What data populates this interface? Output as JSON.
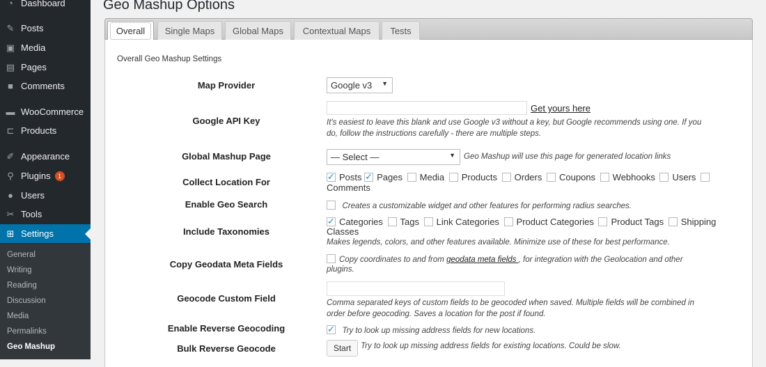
{
  "sidebar": {
    "items": [
      {
        "label": "Dashboard",
        "icon": "dashboard-icon"
      },
      {
        "label": "Posts",
        "icon": "pin-icon"
      },
      {
        "label": "Media",
        "icon": "media-icon"
      },
      {
        "label": "Pages",
        "icon": "pages-icon"
      },
      {
        "label": "Comments",
        "icon": "comment-icon"
      },
      {
        "label": "WooCommerce",
        "icon": "woocommerce-icon"
      },
      {
        "label": "Products",
        "icon": "cart-icon"
      },
      {
        "label": "Appearance",
        "icon": "brush-icon"
      },
      {
        "label": "Plugins",
        "icon": "plug-icon",
        "badge": "1"
      },
      {
        "label": "Users",
        "icon": "user-icon"
      },
      {
        "label": "Tools",
        "icon": "wrench-icon"
      },
      {
        "label": "Settings",
        "icon": "settings-icon"
      }
    ],
    "submenu": [
      "General",
      "Writing",
      "Reading",
      "Discussion",
      "Media",
      "Permalinks",
      "Geo Mashup"
    ],
    "colors": {
      "bg": "#23282d",
      "active": "#0073aa",
      "submenu_bg": "#32373c"
    }
  },
  "page": {
    "title": "Geo Mashup Options"
  },
  "tabs": [
    "Overall",
    "Single Maps",
    "Global Maps",
    "Contextual Maps",
    "Tests"
  ],
  "section_title": "Overall Geo Mashup Settings",
  "settings": {
    "map_provider": {
      "label": "Map Provider",
      "value": "Google v3"
    },
    "google_api_key": {
      "label": "Google API Key",
      "value": "",
      "link": "Get yours here",
      "desc_line1": "It's easiest to leave this blank and use Google v3 without a key, but Google recommends using one. If you",
      "desc_line2": "do, follow the instructions carefully - there are multiple steps."
    },
    "global_mashup_page": {
      "label": "Global Mashup Page",
      "value": "— Select —",
      "desc": "Geo Mashup will use this page for generated location links"
    },
    "collect_location": {
      "label": "Collect Location For",
      "options": [
        "Posts",
        "Pages",
        "Media",
        "Products",
        "Orders",
        "Coupons",
        "Webhooks",
        "Users",
        "Comments"
      ]
    },
    "geo_search": {
      "label": "Enable Geo Search",
      "desc": "Creates a customizable widget and other features for performing radius searches."
    },
    "taxonomies": {
      "label": "Include Taxonomies",
      "options": [
        "Categories",
        "Tags",
        "Link Categories",
        "Product Categories",
        "Product Tags",
        "Shipping",
        "Classes"
      ],
      "desc": "Makes legends, colors, and other features available. Minimize use of these for best performance."
    },
    "copy_meta": {
      "label": "Copy Geodata Meta Fields",
      "desc_pre": "Copy coordinates to and from ",
      "desc_link": "geodata meta fields ",
      "desc_post": ", for integration with the Geolocation and other",
      "desc_line2": "plugins."
    },
    "geocode_custom": {
      "label": "Geocode Custom Field",
      "value": "",
      "desc_line1": "Comma separated keys of custom fields to be geocoded when saved. Multiple fields will be combined in",
      "desc_line2": "order before geocoding. Saves a location for the post if found."
    },
    "reverse_geocoding": {
      "label": "Enable Reverse Geocoding",
      "desc": "Try to look up missing address fields for new locations."
    },
    "bulk_reverse": {
      "label": "Bulk Reverse Geocode",
      "button": "Start",
      "desc": "Try to look up missing address fields for existing locations. Could be slow."
    }
  }
}
